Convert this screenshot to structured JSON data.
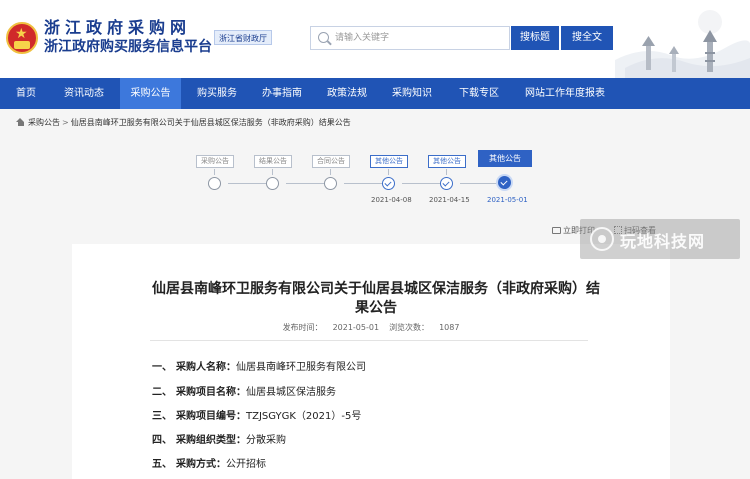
{
  "header": {
    "title": "浙江政府采购网",
    "subtitle": "浙江政府购买服务信息平台",
    "badge": "浙江省财政厅"
  },
  "search": {
    "placeholder": "请输入关键字",
    "title_button": "搜标题",
    "full_button": "搜全文"
  },
  "nav": {
    "items": [
      {
        "label": "首页"
      },
      {
        "label": "资讯动态"
      },
      {
        "label": "采购公告"
      },
      {
        "label": "购买服务"
      },
      {
        "label": "办事指南"
      },
      {
        "label": "政策法规"
      },
      {
        "label": "采购知识"
      },
      {
        "label": "下载专区"
      },
      {
        "label": "网站工作年度报表"
      }
    ],
    "active_index": 2
  },
  "breadcrumb": {
    "root": "采购公告",
    "separator": ">",
    "current": "仙居县南峰环卫服务有限公司关于仙居县城区保洁服务（非政府采购）结果公告"
  },
  "progress": {
    "steps": [
      {
        "label": "采购公告",
        "date": "",
        "status": "pending"
      },
      {
        "label": "结果公告",
        "date": "",
        "status": "pending"
      },
      {
        "label": "合同公告",
        "date": "",
        "status": "pending"
      },
      {
        "label": "其他公告",
        "date": "2021-04-08",
        "status": "done"
      },
      {
        "label": "其他公告",
        "date": "2021-04-15",
        "status": "done"
      },
      {
        "label": "其他公告",
        "date": "2021-05-01",
        "status": "current"
      }
    ]
  },
  "utility": {
    "print": "立即打印",
    "scan": "扫码查看"
  },
  "watermark": "玩地科技网",
  "article": {
    "title": "仙居县南峰环卫服务有限公司关于仙居县城区保洁服务（非政府采购）结果公告",
    "publish_label": "发布时间：",
    "publish_time": "2021-05-01",
    "views_label": "浏览次数：",
    "views": "1087",
    "fields": [
      {
        "num": "一、",
        "label": "采购人名称：",
        "value": "仙居县南峰环卫服务有限公司"
      },
      {
        "num": "二、",
        "label": "采购项目名称：",
        "value": "仙居县城区保洁服务"
      },
      {
        "num": "三、",
        "label": "采购项目编号：",
        "value": "TZJSGYGK（2021）-5号"
      },
      {
        "num": "四、",
        "label": "采购组织类型：",
        "value": "分散采购"
      },
      {
        "num": "五、",
        "label": "采购方式：",
        "value": "公开招标"
      }
    ]
  },
  "colors": {
    "primary": "#2054b5",
    "nav_active": "#3d78dc",
    "title_text": "#1a3d8f"
  }
}
